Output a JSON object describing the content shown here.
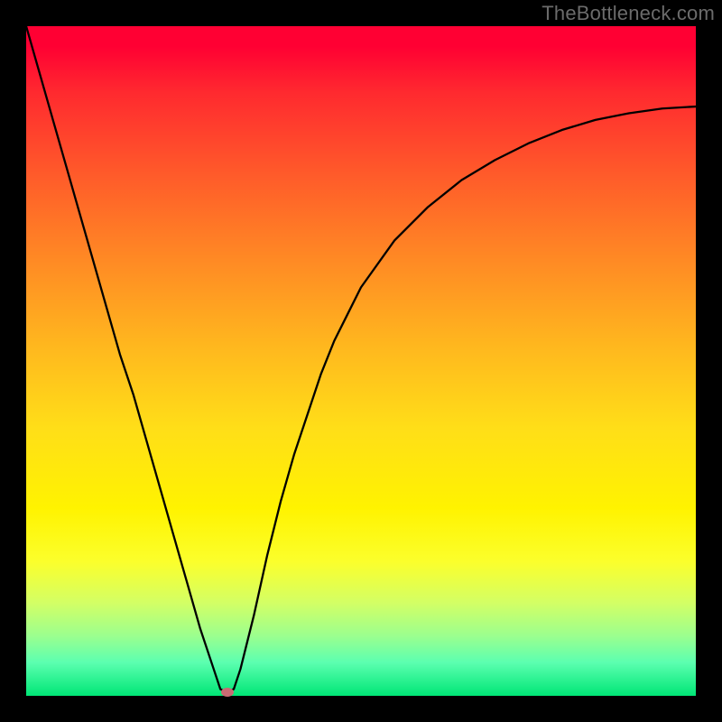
{
  "watermark": "TheBottleneck.com",
  "chart_data": {
    "type": "line",
    "title": "",
    "xlabel": "",
    "ylabel": "",
    "xlim": [
      0,
      100
    ],
    "ylim": [
      0,
      100
    ],
    "grid": false,
    "legend": false,
    "series": [
      {
        "name": "bottleneck-curve",
        "x": [
          0,
          2,
          4,
          6,
          8,
          10,
          12,
          14,
          16,
          18,
          20,
          22,
          24,
          26,
          28,
          29,
          30,
          31,
          32,
          34,
          36,
          38,
          40,
          42,
          44,
          46,
          48,
          50,
          55,
          60,
          65,
          70,
          75,
          80,
          85,
          90,
          95,
          100
        ],
        "y": [
          100,
          93,
          86,
          79,
          72,
          65,
          58,
          51,
          45,
          38,
          31,
          24,
          17,
          10,
          4,
          1,
          0.5,
          1,
          4,
          12,
          21,
          29,
          36,
          42,
          48,
          53,
          57,
          61,
          68,
          73,
          77,
          80,
          82.5,
          84.5,
          86,
          87,
          87.7,
          88
        ]
      }
    ],
    "marker": {
      "x": 30,
      "y": 0.5
    },
    "background_gradient": {
      "top": "#ff0033",
      "mid": "#fff300",
      "bottom": "#00e676"
    }
  }
}
